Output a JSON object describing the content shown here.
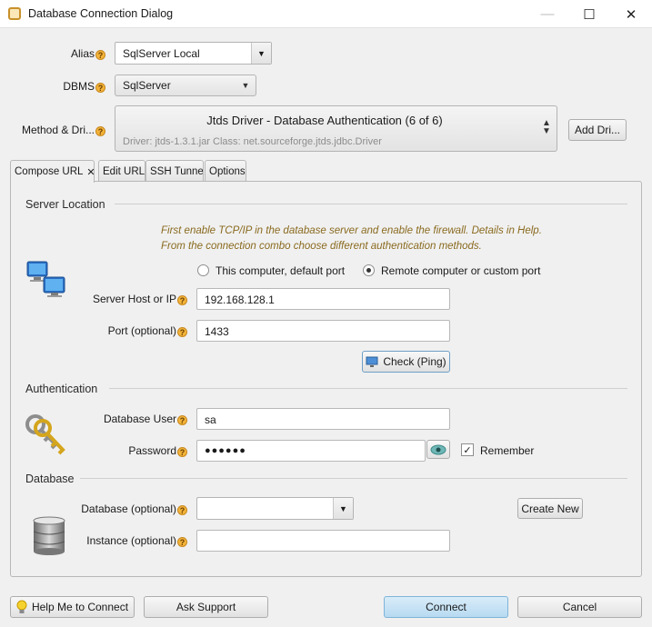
{
  "window": {
    "title": "Database Connection Dialog",
    "minimize": "—",
    "maximize": "☐",
    "close": "✕"
  },
  "alias": {
    "label": "Alias",
    "value": "SqlServer Local"
  },
  "dbms": {
    "label": "DBMS",
    "value": "SqlServer"
  },
  "method": {
    "label": "Method & Dri...",
    "title": "Jtds Driver - Database Authentication (6 of 6)",
    "subtitle": "Driver: jtds-1.3.1.jar Class: net.sourceforge.jtds.jdbc.Driver",
    "add_button": "Add Dri..."
  },
  "tabs": [
    {
      "label": "Compose URL",
      "close": "✕"
    },
    {
      "label": "Edit URL"
    },
    {
      "label": "SSH Tunnel"
    },
    {
      "label": "Options"
    }
  ],
  "server": {
    "section": "Server Location",
    "info_line1": "First enable TCP/IP in the database server and enable the firewall. Details in Help.",
    "info_line2": "From the connection combo choose different authentication methods.",
    "radio_this": "This computer, default port",
    "radio_remote": "Remote computer or custom port",
    "host_label": "Server Host or IP",
    "host_value": "192.168.128.1",
    "port_label": "Port (optional)",
    "port_value": "1433",
    "check_button": "Check (Ping)"
  },
  "auth": {
    "section": "Authentication",
    "user_label": "Database User",
    "user_value": "sa",
    "password_label": "Password",
    "password_value": "●●●●●●",
    "remember_label": "Remember"
  },
  "database": {
    "section": "Database",
    "db_label": "Database (optional)",
    "db_value": "",
    "create_button": "Create New",
    "instance_label": "Instance (optional)",
    "instance_value": ""
  },
  "footer": {
    "help_button": "Help Me to Connect",
    "support_button": "Ask Support",
    "connect_button": "Connect",
    "cancel_button": "Cancel"
  },
  "help_glyph": "?"
}
